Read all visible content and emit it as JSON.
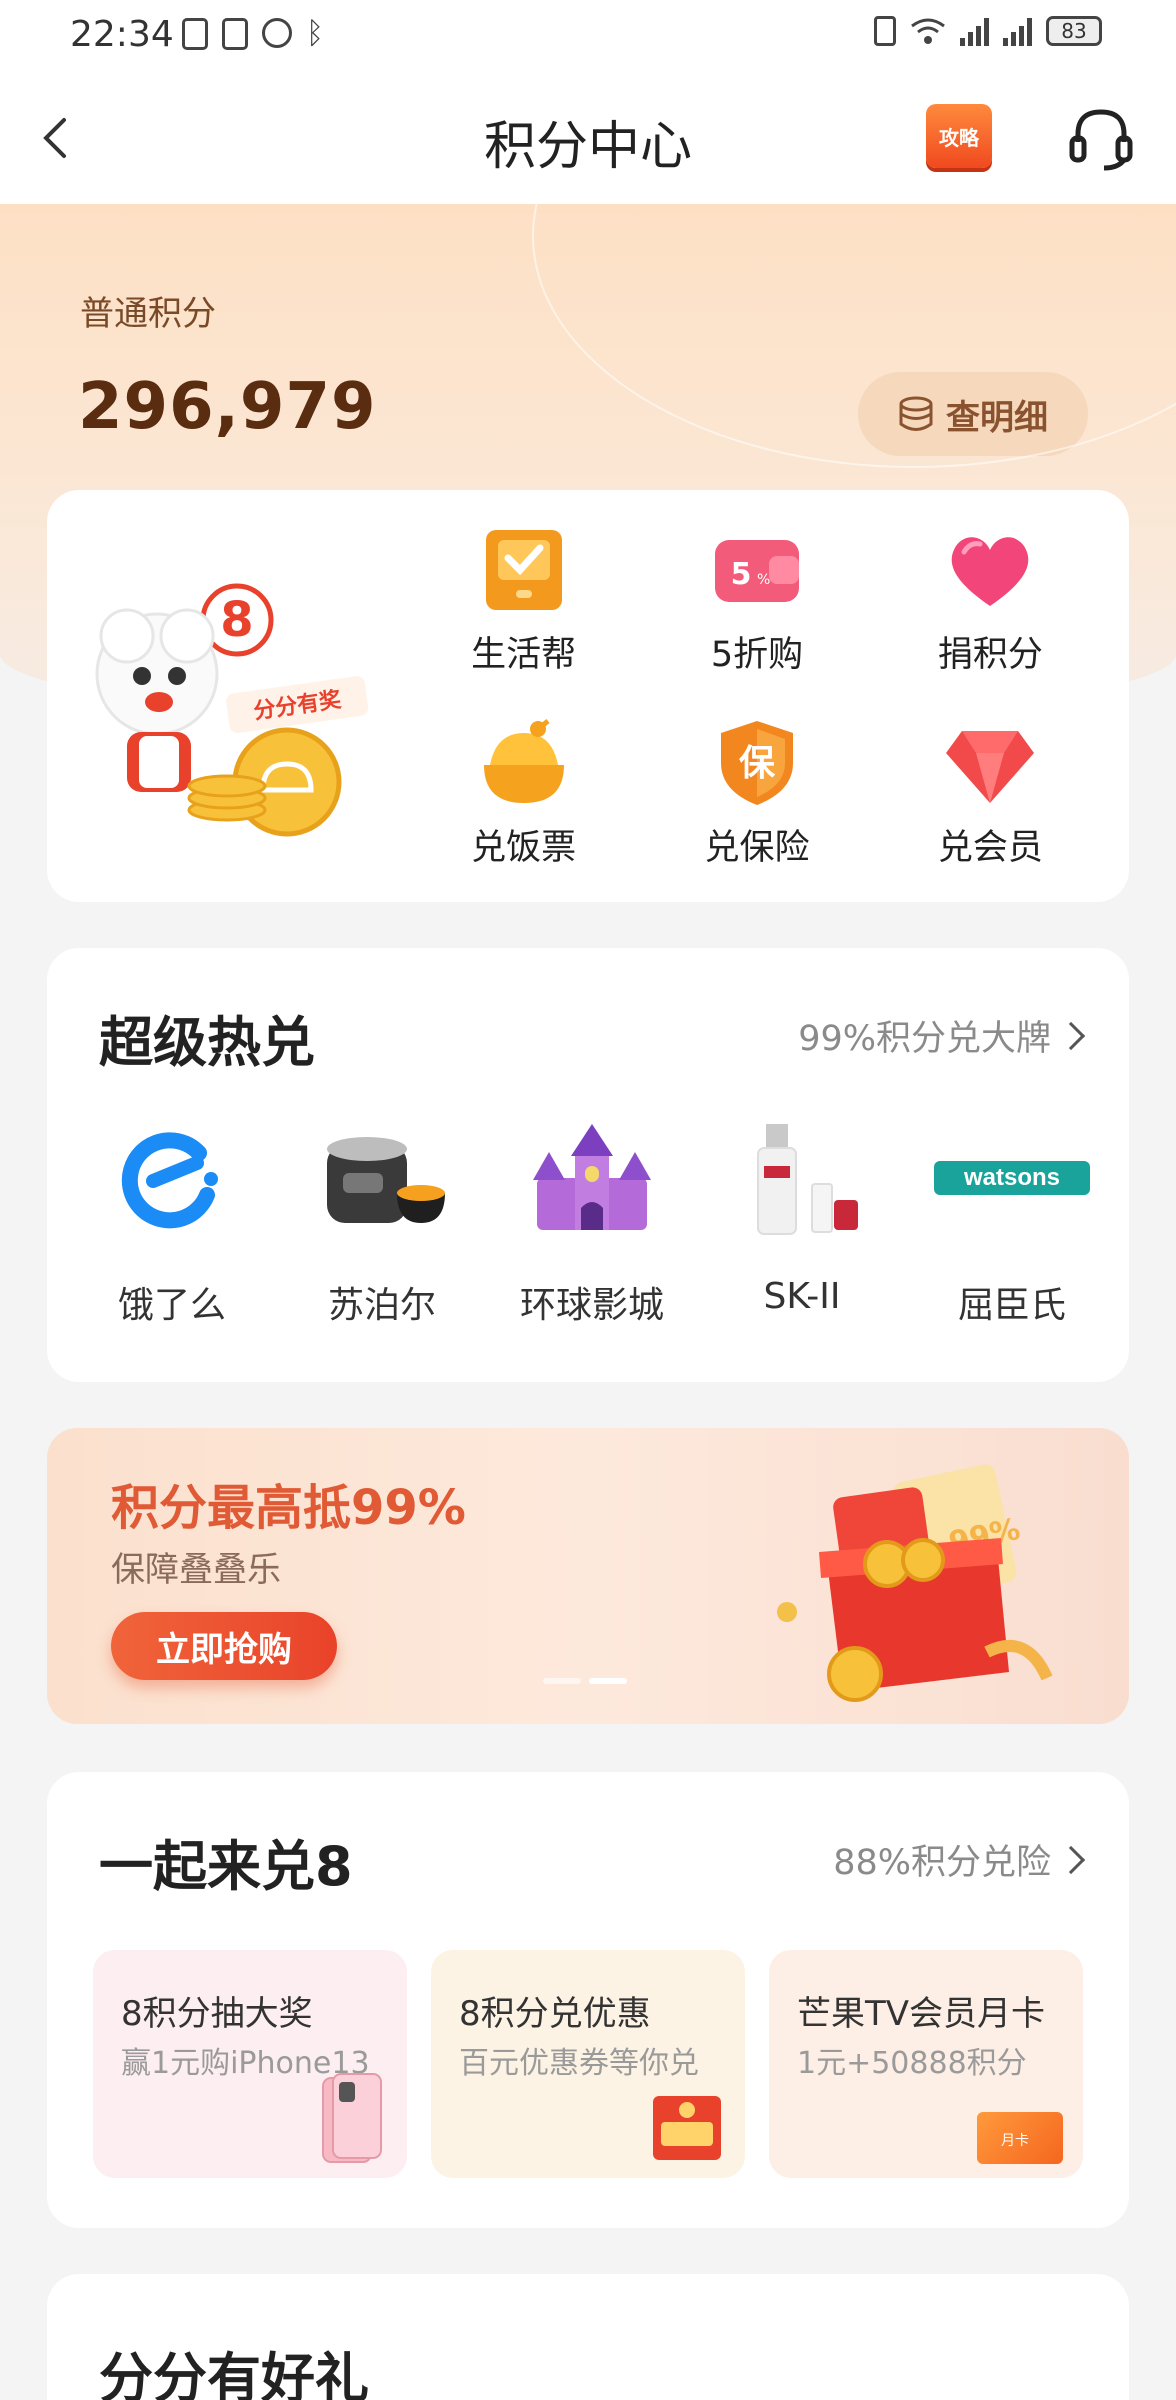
{
  "status_bar": {
    "time": "22:34",
    "battery": "83"
  },
  "nav": {
    "title": "积分中心",
    "strategy_badge": "攻略"
  },
  "hero": {
    "points_label": "普通积分",
    "points_value": "296,979",
    "detail_button": "查明细"
  },
  "mascot": {
    "badge_text": "分分有奖"
  },
  "quick_menu": [
    {
      "label": "生活帮",
      "icon": "checkbox-icon"
    },
    {
      "label": "5折购",
      "icon": "discount-wallet-icon"
    },
    {
      "label": "捐积分",
      "icon": "heart-icon"
    },
    {
      "label": "兑饭票",
      "icon": "rice-bowl-icon"
    },
    {
      "label": "兑保险",
      "icon": "insurance-shield-icon",
      "glyph": "保"
    },
    {
      "label": "兑会员",
      "icon": "diamond-icon"
    }
  ],
  "hot_exchange": {
    "title": "超级热兑",
    "more": "99%积分兑大牌",
    "brands": [
      {
        "name": "饿了么",
        "icon": "eleme-logo"
      },
      {
        "name": "苏泊尔",
        "icon": "rice-cooker-image"
      },
      {
        "name": "环球影城",
        "icon": "castle-image"
      },
      {
        "name": "SK-II",
        "icon": "skincare-bottle-image"
      },
      {
        "name": "屈臣氏",
        "icon": "watsons-logo",
        "logo_text": "watsons"
      }
    ]
  },
  "banner": {
    "title": "积分最高抵99%",
    "subtitle": "保障叠叠乐",
    "button": "立即抢购",
    "gift_tag": "99%"
  },
  "exchange8": {
    "title": "一起来兑8",
    "more": "88%积分兑险",
    "tiles": [
      {
        "title": "8积分抽大奖",
        "subtitle": "赢1元购iPhone13",
        "bg": "#fdeef2"
      },
      {
        "title": "8积分兑优惠",
        "subtitle": "百元优惠券等你兑",
        "bg": "#fdf3e4"
      },
      {
        "title": "芒果TV会员月卡",
        "subtitle": "1元+50888积分",
        "bg": "#fdefe6",
        "card_text": "月卡"
      }
    ]
  },
  "gifts": {
    "title": "分分有好礼"
  }
}
